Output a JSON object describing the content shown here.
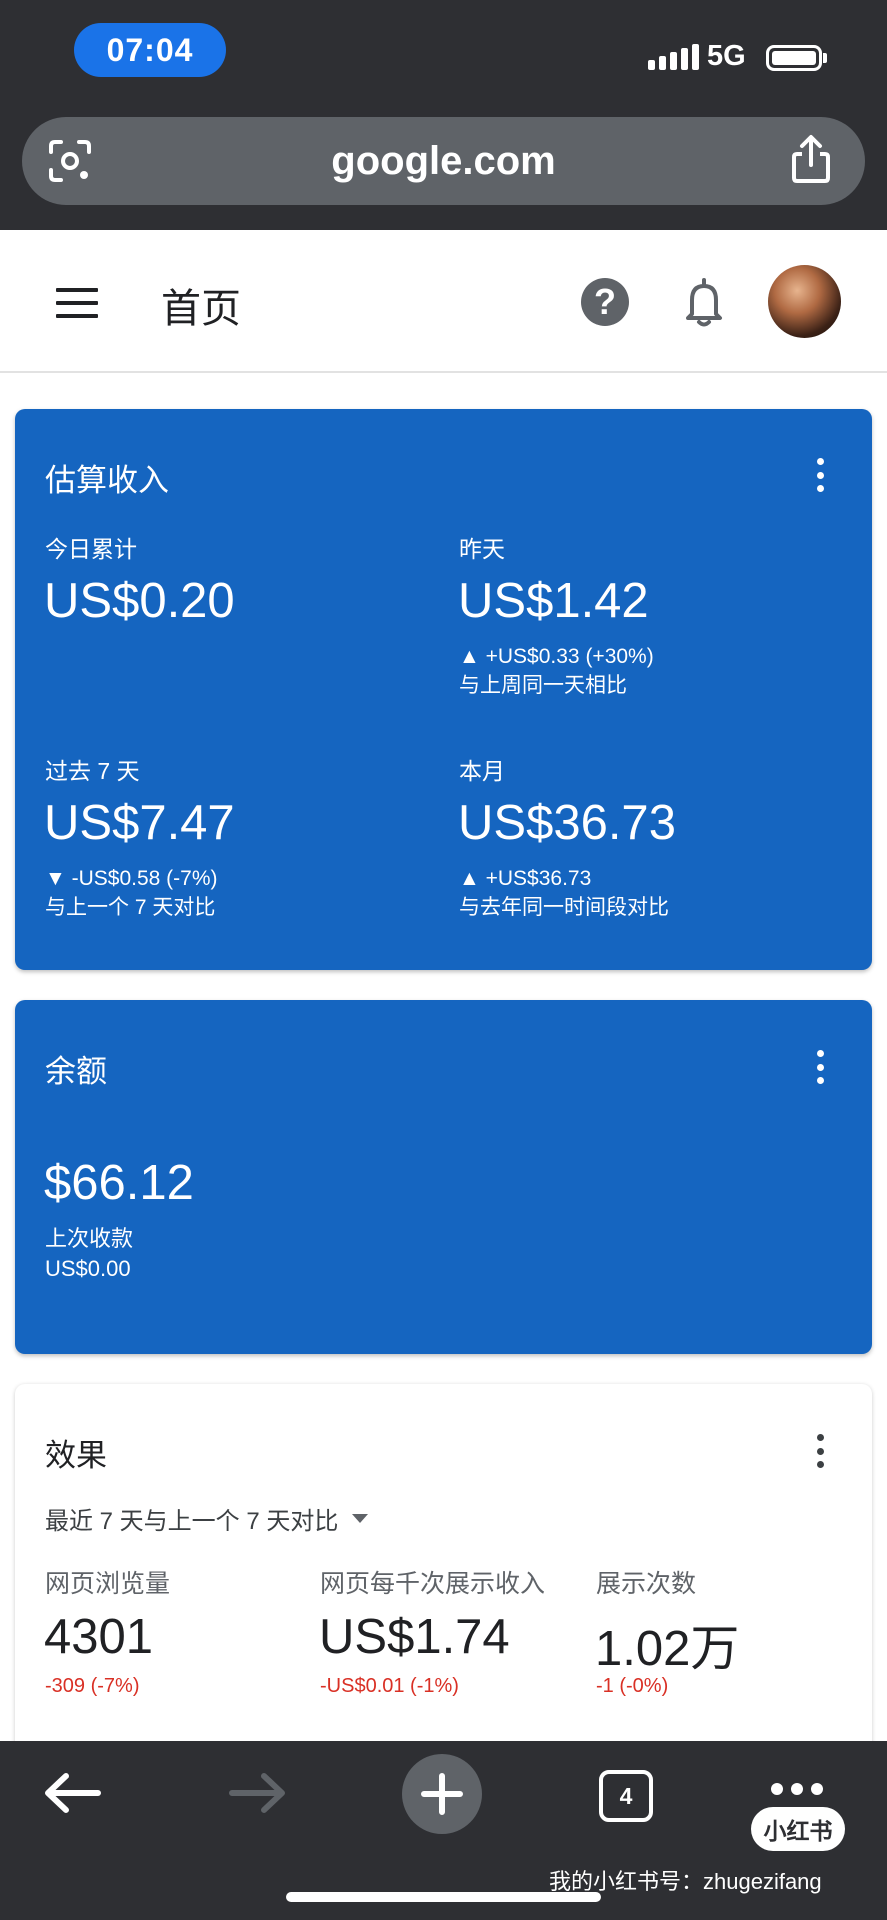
{
  "status_bar": {
    "time": "07:04",
    "network": "5G"
  },
  "browser": {
    "url": "google.com"
  },
  "app_header": {
    "title": "首页"
  },
  "estimated_earnings": {
    "title": "估算收入",
    "today": {
      "label": "今日累计",
      "value": "US$0.20"
    },
    "yesterday": {
      "label": "昨天",
      "value": "US$1.42",
      "change": "▲ +US$0.33 (+30%)",
      "compare": "与上周同一天相比"
    },
    "last7": {
      "label": "过去 7 天",
      "value": "US$7.47",
      "change": "▼ -US$0.58 (-7%)",
      "compare": "与上一个 7 天对比"
    },
    "this_month": {
      "label": "本月",
      "value": "US$36.73",
      "change": "▲ +US$36.73",
      "compare": "与去年同一时间段对比"
    }
  },
  "balance": {
    "title": "余额",
    "value": "$66.12",
    "last_payment_label": "上次收款",
    "last_payment_value": "US$0.00"
  },
  "performance": {
    "title": "效果",
    "range": "最近 7 天与上一个 7 天对比",
    "metrics": [
      {
        "label": "网页浏览量",
        "value": "4301",
        "delta": "-309 (-7%)"
      },
      {
        "label": "网页每千次展示收入",
        "value": "US$1.74",
        "delta": "-US$0.01 (-1%)"
      },
      {
        "label": "展示次数",
        "value": "1.02万",
        "delta": "-1 (-0%)"
      }
    ]
  },
  "toolbar": {
    "tab_count": "4"
  },
  "watermark": {
    "badge": "小红书",
    "text": "我的小红书号：zhugezifang"
  },
  "colors": {
    "card_blue": "#1565c0",
    "chrome_dark": "#2e2f33",
    "negative": "#d93025",
    "pill_blue": "#1a73e8"
  }
}
